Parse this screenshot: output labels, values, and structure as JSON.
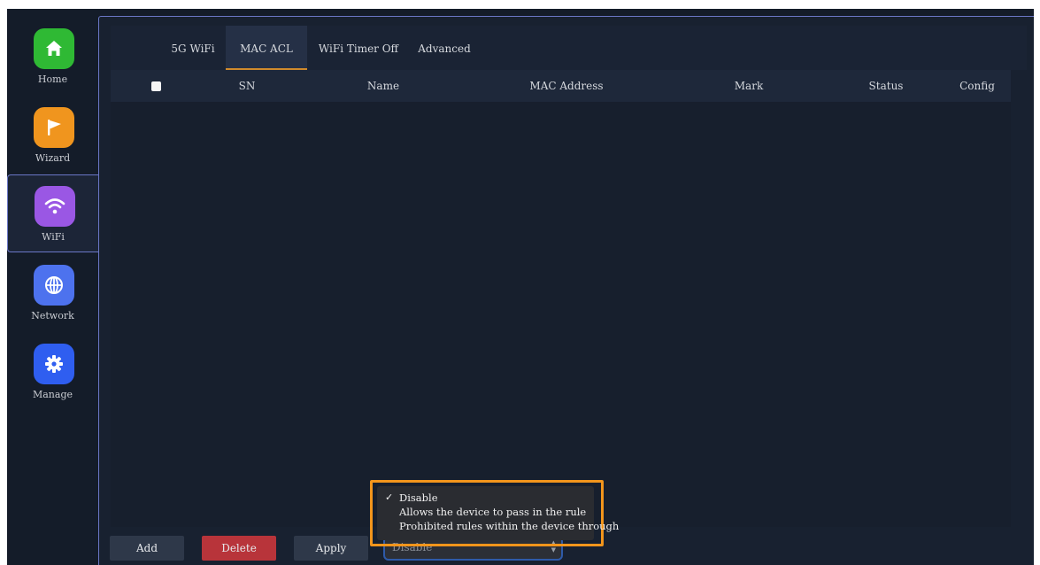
{
  "sidebar": {
    "items": [
      {
        "label": "Home",
        "icon": "home-icon",
        "color": "#2fb934",
        "active": false
      },
      {
        "label": "Wizard",
        "icon": "flag-icon",
        "color": "#f0951e",
        "active": false
      },
      {
        "label": "WiFi",
        "icon": "wifi-icon",
        "color": "#9a57e4",
        "active": true
      },
      {
        "label": "Network",
        "icon": "globe-icon",
        "color": "#4d72ee",
        "active": false
      },
      {
        "label": "Manage",
        "icon": "gear-icon",
        "color": "#2f5ef0",
        "active": false
      }
    ]
  },
  "tabs": [
    {
      "label": "5G WiFi",
      "active": false
    },
    {
      "label": "MAC ACL",
      "active": true
    },
    {
      "label": "WiFi Timer Off",
      "active": false
    },
    {
      "label": "Advanced",
      "active": false
    }
  ],
  "table": {
    "columns": [
      "SN",
      "Name",
      "MAC Address",
      "Mark",
      "Status",
      "Config"
    ],
    "rows": []
  },
  "buttons": {
    "add": "Add",
    "delete": "Delete",
    "apply": "Apply"
  },
  "mode_select": {
    "value": "Disable",
    "options": [
      {
        "label": "Disable",
        "selected": true
      },
      {
        "label": "Allows the device to pass in the rule",
        "selected": false
      },
      {
        "label": "Prohibited rules within the device through",
        "selected": false
      }
    ]
  },
  "colors": {
    "accent_highlight": "#f2951c",
    "active_tab_underline": "#d08a2c",
    "delete_button": "#b8343a",
    "panel_border": "#6a76c6"
  }
}
